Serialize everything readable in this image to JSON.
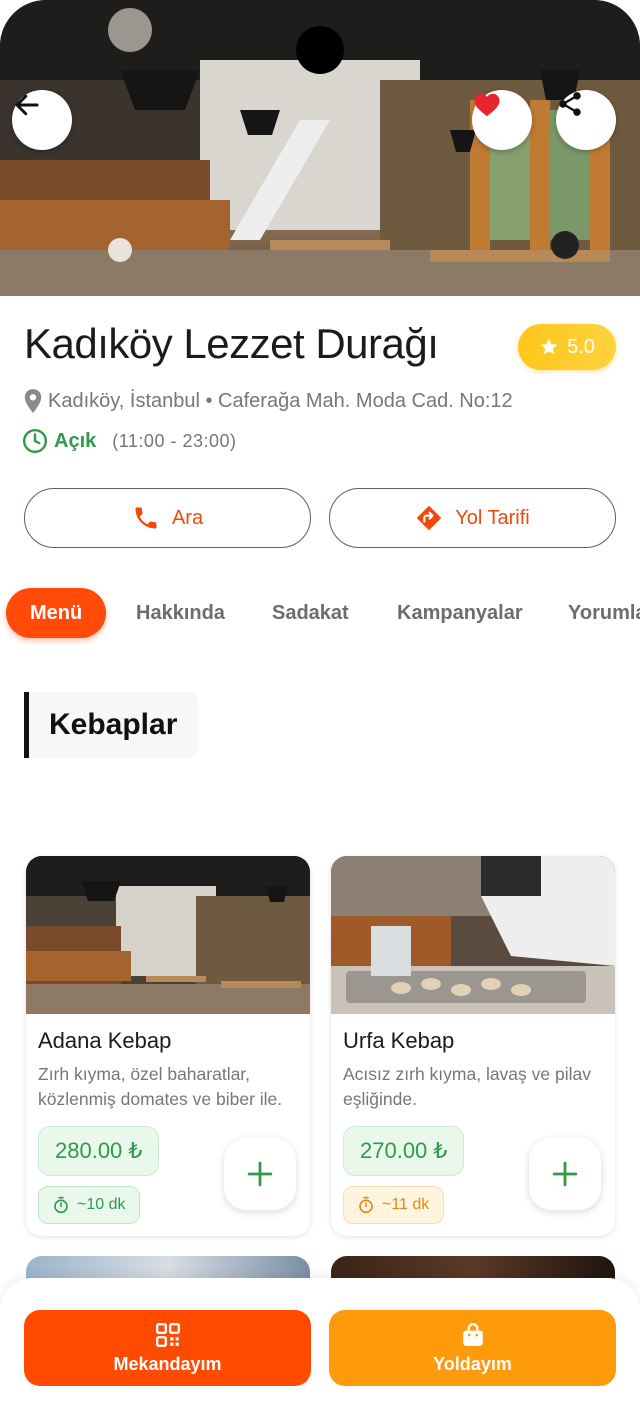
{
  "restaurant": {
    "name": "Kadıköy Lezzet Durağı",
    "rating": "5.0",
    "address": "Kadıköy, İstanbul • Caferağa Mah. Moda Cad. No:12",
    "status": "Açık",
    "hours": "(11:00 - 23:00)"
  },
  "actions": {
    "call_label": "Ara",
    "directions_label": "Yol Tarifi"
  },
  "tabs": [
    {
      "label": "Menü",
      "active": true
    },
    {
      "label": "Hakkında",
      "active": false
    },
    {
      "label": "Sadakat",
      "active": false
    },
    {
      "label": "Kampanyalar",
      "active": false
    },
    {
      "label": "Yorumlar",
      "active": false
    }
  ],
  "section": {
    "title": "Kebaplar"
  },
  "menu_items": [
    {
      "name": "Adana Kebap",
      "description": "Zırh kıyma, özel baharatlar, közlenmiş domates ve biber ile.",
      "price": "280.00 ₺",
      "prep_time": "~10 dk",
      "prep_color": "green"
    },
    {
      "name": "Urfa Kebap",
      "description": "Acısız zırh kıyma, lavaş ve pilav eşliğinde.",
      "price": "270.00 ₺",
      "prep_time": "~11 dk",
      "prep_color": "orange"
    }
  ],
  "bottom_bar": {
    "here_label": "Mekandayım",
    "onway_label": "Yoldayım"
  },
  "colors": {
    "accent": "#ff4a0a",
    "secondary": "#ff9a0a",
    "green": "#2d9b4a",
    "rating": "#ffc61a",
    "favorite": "#e8242c"
  },
  "icons": {
    "back": "arrow-left-icon",
    "favorite": "heart-icon",
    "share": "share-icon",
    "location": "location-pin-icon",
    "clock": "clock-icon",
    "phone": "phone-icon",
    "directions": "directions-icon",
    "add": "plus-icon",
    "timer": "stopwatch-icon",
    "qr": "qr-code-icon",
    "bag": "shopping-bag-icon"
  }
}
